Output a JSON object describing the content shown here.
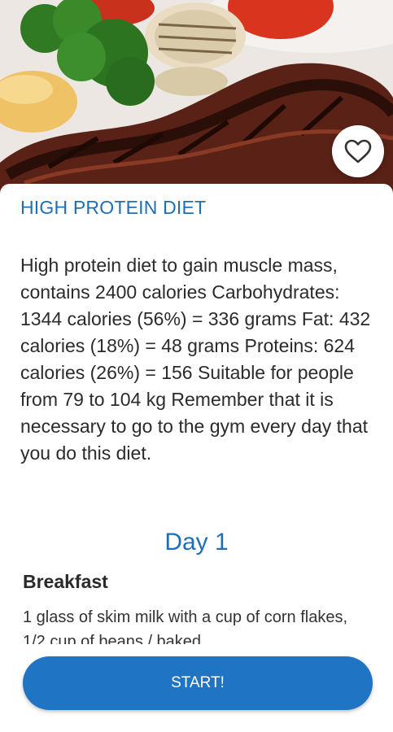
{
  "hero": {
    "alt": "Grilled steak with broccoli, potatoes, onion and tomato"
  },
  "favorite": {
    "icon": "heart-outline-icon"
  },
  "diet": {
    "title": "HIGH PROTEIN DIET",
    "description": "High protein diet to gain muscle mass, contains 2400 calories Carbohydrates: 1344 calories (56%) = 336 grams Fat: 432 calories (18%) = 48 grams Proteins: 624 calories (26%) = 156 Suitable for people from 79 to 104 kg Remember that it is necessary to go to the gym every day that you do this diet."
  },
  "plan": {
    "day": "Day 1",
    "meal_title": "Breakfast",
    "meal_body": "1 glass of skim milk with a cup of corn flakes, 1/2 cup of beans / baked"
  },
  "actions": {
    "start_label": "START!"
  },
  "colors": {
    "accent": "#1f6fb5",
    "button": "#1f75c4"
  }
}
